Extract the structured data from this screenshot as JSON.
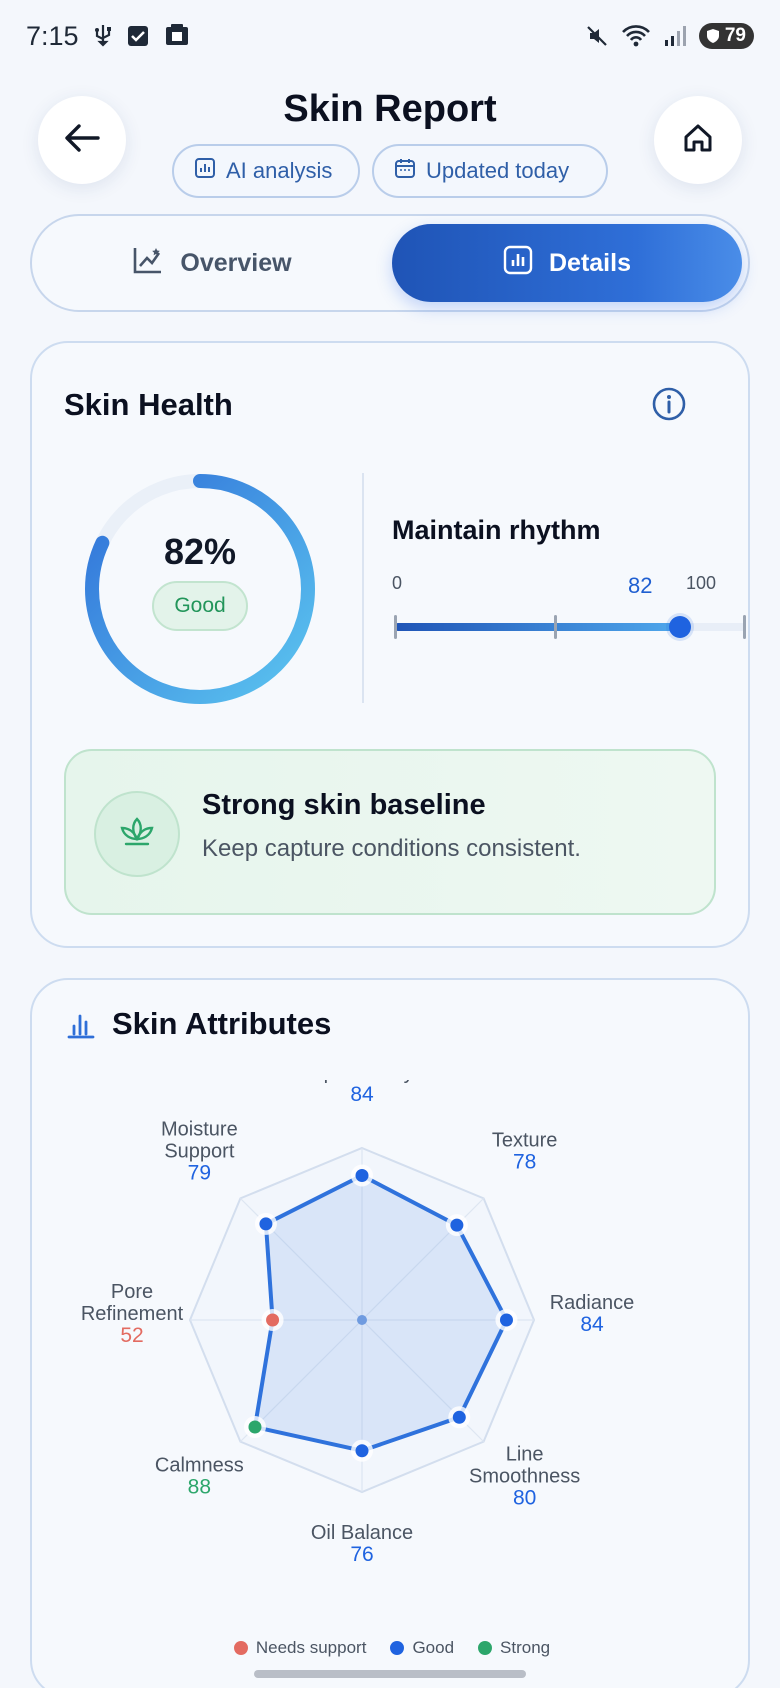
{
  "status_bar": {
    "time": "7:15",
    "battery": "79",
    "icons": [
      "usb-icon",
      "checkbox-icon",
      "clipboard-icon",
      "mute-icon",
      "wifi-icon",
      "signal-icon",
      "battery-icon"
    ]
  },
  "header": {
    "title": "Skin Report",
    "chips": [
      {
        "label": "AI analysis",
        "icon": "chart-icon"
      },
      {
        "label": "Updated today",
        "icon": "calendar-icon"
      }
    ]
  },
  "tabs": [
    {
      "label": "Overview",
      "icon": "trend-chart-icon",
      "active": false
    },
    {
      "label": "Details",
      "icon": "bar-chart-icon",
      "active": true
    }
  ],
  "skin_health": {
    "title": "Skin Health",
    "score_text": "82%",
    "score": 82,
    "rating": "Good",
    "rhythm_title": "Maintain rhythm",
    "scale_min": "0",
    "scale_value": "82",
    "scale_max": "100",
    "baseline_title": "Strong skin baseline",
    "baseline_text": "Keep capture conditions consistent."
  },
  "skin_attributes": {
    "title": "Skin Attributes",
    "items": [
      {
        "name": "Spot Clarity",
        "value": 84,
        "status": "good"
      },
      {
        "name": "Texture",
        "value": 78,
        "status": "good"
      },
      {
        "name": "Radiance",
        "value": 84,
        "status": "good"
      },
      {
        "name": "Line Smoothness",
        "value": 80,
        "status": "good"
      },
      {
        "name": "Oil Balance",
        "value": 76,
        "status": "good"
      },
      {
        "name": "Calmness",
        "value": 88,
        "status": "strong"
      },
      {
        "name": "Pore Refinement",
        "value": 52,
        "status": "needs"
      },
      {
        "name": "Moisture Support",
        "value": 79,
        "status": "good"
      }
    ],
    "legend": [
      {
        "label": "Needs support",
        "color": "#e36b61"
      },
      {
        "label": "Good",
        "color": "#1f63e0"
      },
      {
        "label": "Strong",
        "color": "#2ca66b"
      }
    ]
  },
  "colors": {
    "accent": "#1f63e0",
    "good": "#1f63e0",
    "strong": "#2ca66b",
    "needs": "#e36b61"
  }
}
